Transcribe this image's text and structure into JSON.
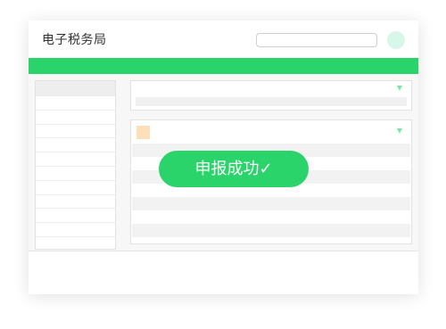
{
  "app": {
    "title": "电子税务局"
  },
  "header": {
    "search_placeholder": ""
  },
  "toast": {
    "message": "申报成功✓"
  },
  "colors": {
    "accent": "#2bd46b",
    "avatar": "#d7f8e8",
    "marker": "#fde0b8"
  },
  "icons": {
    "dropdown": "chevron-down-icon",
    "user": "avatar"
  }
}
